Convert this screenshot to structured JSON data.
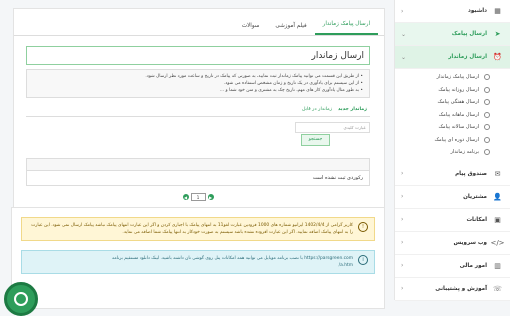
{
  "sidebar": {
    "items": [
      {
        "label": "داشبود",
        "icon": "grid-icon"
      },
      {
        "label": "ارسال پیامک",
        "icon": "send-icon"
      },
      {
        "label": "ارسال زماندار",
        "icon": "alarm-clock-icon"
      }
    ],
    "submenu": [
      "ارسال پیامک زماندار",
      "ارسال روزانه پیامک",
      "ارسال هفتگی پیامک",
      "ارسال ماهانه پیامک",
      "ارسال سالانه پیامک",
      "ارسال دوره ای پیامک",
      "برنامه زماندار"
    ],
    "lower_items": [
      {
        "label": "صندوق پیام",
        "icon": "inbox-icon"
      },
      {
        "label": "مشتریان",
        "icon": "user-icon"
      },
      {
        "label": "امکانات",
        "icon": "apps-icon"
      },
      {
        "label": "وب سرویس",
        "icon": "code-icon"
      },
      {
        "label": "امور مالی",
        "icon": "chart-icon"
      },
      {
        "label": "آموزش و پشتیبانی",
        "icon": "support-icon"
      }
    ]
  },
  "tabs": [
    "ارسال پیامک زماندار",
    "فیلم آموزشی",
    "سوالات"
  ],
  "page_title": "ارسال زماندار",
  "info_lines": [
    "از طریق این قسمت می توانید پیامک زماندار ثبت نمایید، به صورتی که پیامک در تاریخ و ساعت مورد نظر ارسال شود.",
    "از این سیستم برای یادآوری در یک تاریخ و زمان مشخص استفاده می شود.",
    "به طور مثال یادآوری کار های مهم، تاریخ چک به مشتری و متن خود شما و ..."
  ],
  "filter_tabs": [
    "زماندار در قابل",
    "زماندار جدید"
  ],
  "search": {
    "placeholder": "عبارت کلیدی",
    "button": "جستجو"
  },
  "list": {
    "empty_text": "رکوردی ثبت نشده است"
  },
  "pager": {
    "page": "1"
  },
  "alerts": {
    "warning": "کاربر گرامی از 1402/4/4 ایرانیو شماره های 1000 فرودین عبارت لغو11 به انتهای پیامک با اجباری کردن و اگر این عبارت انتهای پیامک نباشد پیامک ارسال نمی شود. این عبارت را به انتهای پیامک اضافه نمایید. اگر این عبارت افزوده نشده باشد سیستم به صورت خودکار به انتها پیامک شما اضافه می نماید.",
    "info": "https://parsgreen.com با نصب برنامه موبایل می توانید همه امکانات پنل روی گوشی تان داشته باشید. لینک دانلود مستقیم برنامه",
    "info_link": "a.htm/"
  },
  "colors": {
    "accent": "#2e9d5b",
    "warning_bg": "#fff6d6",
    "info_bg": "#dff3f7"
  }
}
